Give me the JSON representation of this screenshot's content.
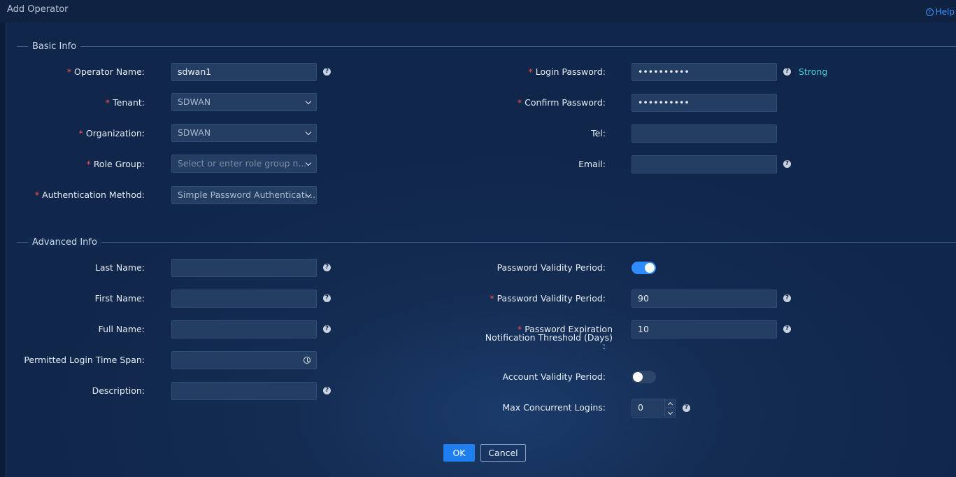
{
  "window": {
    "title": "Add Operator",
    "help_label": "Help"
  },
  "basic": {
    "section_title": "Basic Info",
    "operator_name": {
      "label": "Operator Name:",
      "value": "sdwan1"
    },
    "tenant": {
      "label": "Tenant:",
      "value": "SDWAN"
    },
    "organization": {
      "label": "Organization:",
      "value": "SDWAN"
    },
    "role_group": {
      "label": "Role Group:",
      "placeholder": "Select or enter role group n..."
    },
    "auth_method": {
      "label": "Authentication Method:",
      "value": "Simple Password Authenticati..."
    },
    "login_password": {
      "label": "Login Password:",
      "value": "••••••••••",
      "strength": "Strong"
    },
    "confirm_password": {
      "label": "Confirm Password:",
      "value": "••••••••••"
    },
    "tel": {
      "label": "Tel:",
      "value": ""
    },
    "email": {
      "label": "Email:",
      "value": ""
    }
  },
  "advanced": {
    "section_title": "Advanced Info",
    "last_name": {
      "label": "Last Name:",
      "value": ""
    },
    "first_name": {
      "label": "First Name:",
      "value": ""
    },
    "full_name": {
      "label": "Full Name:",
      "value": ""
    },
    "login_time_span": {
      "label": "Permitted Login Time Span:",
      "value": ""
    },
    "description": {
      "label": "Description:",
      "value": ""
    },
    "pwd_validity_toggle": {
      "label": "Password Validity Period:",
      "enabled": true
    },
    "pwd_validity_period": {
      "label": "Password Validity Period:",
      "value": "90"
    },
    "pwd_exp_notice": {
      "label_line1": "Password Expiration",
      "label_line2": "Notification Threshold (Days)",
      "label_line3": ":",
      "value": "10"
    },
    "account_validity_toggle": {
      "label": "Account Validity Period:",
      "enabled": false
    },
    "max_logins": {
      "label": "Max Concurrent Logins:",
      "value": "0"
    }
  },
  "footer": {
    "ok_label": "OK",
    "cancel_label": "Cancel"
  },
  "colors": {
    "accent": "#1f7ff0",
    "required": "#ff4d4f",
    "strength": "#46d0cf"
  }
}
